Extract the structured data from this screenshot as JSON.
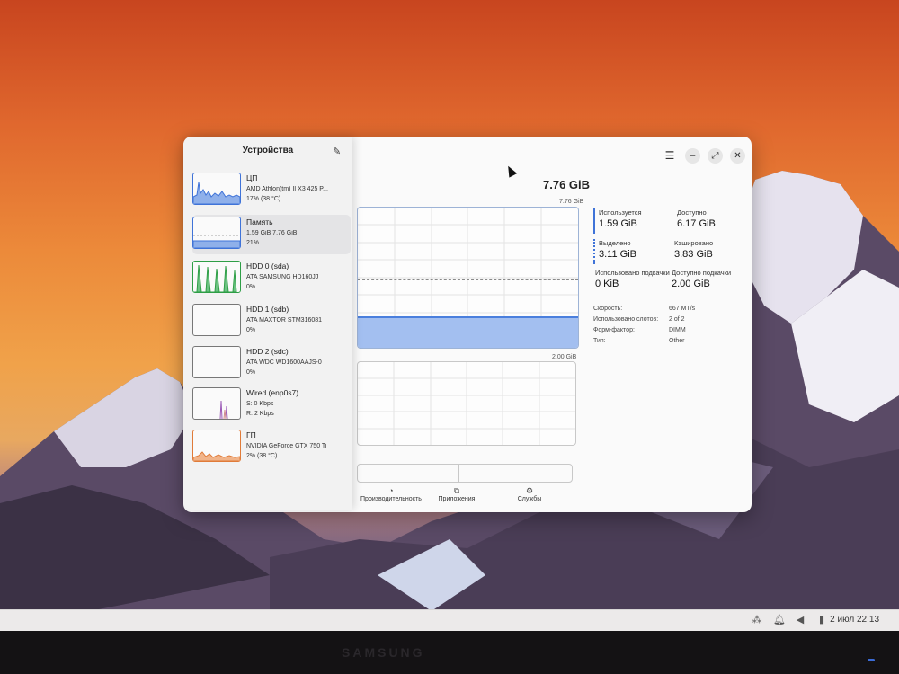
{
  "sidebar": {
    "title": "Устройства",
    "edit_icon": "pencil-icon",
    "items": [
      {
        "name": "ЦП",
        "line1": "AMD Athlon(tm) II X3 425 P...",
        "line2": "17% (38 °C)",
        "color": "#3f73d8"
      },
      {
        "name": "Память",
        "line1": "1.59 GiB 7.76 GiB",
        "line2": "21%",
        "color": "#3f73d8"
      },
      {
        "name": "HDD 0 (sda)",
        "line1": "ATA SAMSUNG HD160JJ",
        "line2": "0%",
        "color": "#2e9e46"
      },
      {
        "name": "HDD 1 (sdb)",
        "line1": "ATA MAXTOR STM316081",
        "line2": "0%",
        "color": "#2e9e46"
      },
      {
        "name": "HDD 2 (sdc)",
        "line1": "ATA WDC WD1600AAJS-0",
        "line2": "0%",
        "color": "#2e9e46"
      },
      {
        "name": "Wired (enp0s7)",
        "line1": "S: 0 Kbps",
        "line2": "R: 2 Kbps",
        "color": "#9b59b6"
      },
      {
        "name": "ГП",
        "line1": "NVIDIA GeForce GTX 750 Ti",
        "line2": "2% (38 °C)",
        "color": "#e07b39"
      }
    ]
  },
  "memory": {
    "total": "7.76 GiB",
    "graph_max_label": "7.76 GiB",
    "swap_max_label": "2.00 GiB",
    "used_fraction": 0.21,
    "cached_fraction": 0.49
  },
  "stats": {
    "used_label": "Используется",
    "used_value": "1.59 GiB",
    "available_label": "Доступно",
    "available_value": "6.17 GiB",
    "allocated_label": "Выделено",
    "allocated_value": "3.11 GiB",
    "cached_label": "Кэшировано",
    "cached_value": "3.83 GiB",
    "swap_used_label": "Использовано подкачки",
    "swap_used_value": "0 KiB",
    "swap_avail_label": "Доступно подкачки",
    "swap_avail_value": "2.00 GiB"
  },
  "details": [
    {
      "key": "Скорость:",
      "value": "667 MT/s"
    },
    {
      "key": "Использовано слотов:",
      "value": "2 of 2"
    },
    {
      "key": "Форм-фактор:",
      "value": "DIMM"
    },
    {
      "key": "Тип:",
      "value": "Other"
    }
  ],
  "tabs": [
    {
      "label": "Производительность",
      "icon": "gauge-icon"
    },
    {
      "label": "Приложения",
      "icon": "apps-icon"
    },
    {
      "label": "Службы",
      "icon": "gears-icon"
    }
  ],
  "window": {
    "menu_icon": "hamburger-icon",
    "minimize_icon": "minimize-icon",
    "maximize_icon": "maximize-icon",
    "close_icon": "close-icon"
  },
  "taskbar": {
    "clock": "2 июл 22:13"
  },
  "bezel": {
    "brand": "SAMSUNG"
  }
}
